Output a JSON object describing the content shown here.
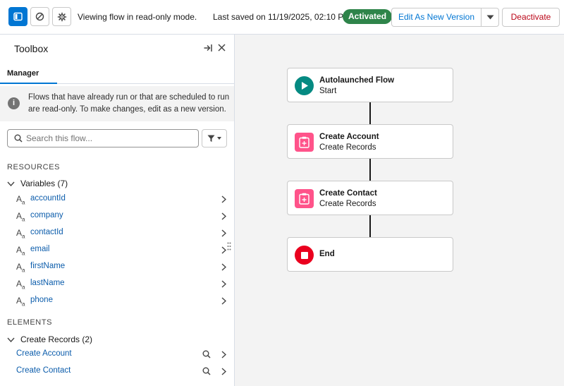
{
  "topbar": {
    "mode_text": "Viewing flow in read-only mode.",
    "saved_text": "Last saved on 11/19/2025, 02:10 PM",
    "status_badge": "Activated",
    "edit_button": "Edit As New Version",
    "deactivate_button": "Deactivate",
    "icons": [
      "toggle-toolbox-icon",
      "errors-icon",
      "settings-gear-icon",
      "chevron-down-icon"
    ]
  },
  "toolbox": {
    "title": "Toolbox",
    "tab": "Manager",
    "notice": "Flows that have already run or that are scheduled to run are read-only. To make changes, edit as a new version.",
    "search_placeholder": "Search this flow...",
    "resources_heading": "RESOURCES",
    "variables_group": "Variables (7)",
    "variables": [
      {
        "type": "A",
        "sub": "a",
        "label": "accountId"
      },
      {
        "type": "A",
        "sub": "a",
        "label": "company"
      },
      {
        "type": "A",
        "sub": "a",
        "label": "contactId"
      },
      {
        "type": "A",
        "sub": "a",
        "label": "email"
      },
      {
        "type": "A",
        "sub": "a",
        "label": "firstName"
      },
      {
        "type": "A",
        "sub": "a",
        "label": "lastName"
      },
      {
        "type": "A",
        "sub": "a",
        "label": "phone"
      }
    ],
    "elements_heading": "ELEMENTS",
    "elements_group": "Create Records (2)",
    "elements": [
      {
        "label": "Create Account"
      },
      {
        "label": "Create Contact"
      }
    ]
  },
  "canvas": {
    "nodes": [
      {
        "title": "Autolaunched Flow",
        "subtitle": "Start",
        "icon": "play-icon"
      },
      {
        "title": "Create Account",
        "subtitle": "Create Records",
        "icon": "record-create-icon"
      },
      {
        "title": "Create Contact",
        "subtitle": "Create Records",
        "icon": "record-create-icon"
      },
      {
        "title": "End",
        "subtitle": "",
        "icon": "stop-icon"
      }
    ]
  },
  "colors": {
    "brand": "#0176d3",
    "success": "#2e844a",
    "danger": "#ba0517",
    "start_node": "#058a82",
    "create_node": "#ff538a",
    "end_node": "#ea001e"
  }
}
